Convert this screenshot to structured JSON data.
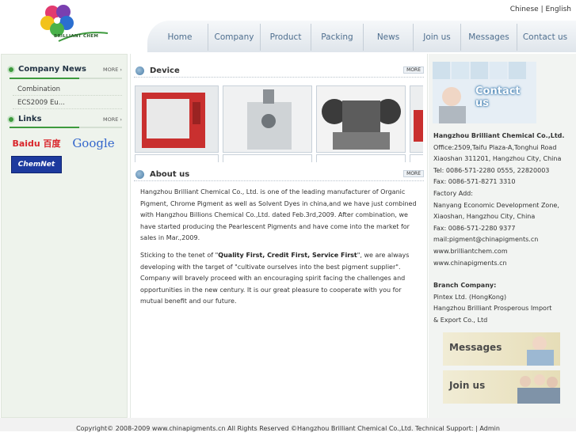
{
  "logo": {
    "text": "BRILLIANT CHEM"
  },
  "lang": {
    "chinese": "Chinese",
    "sep": "|",
    "english": "English"
  },
  "nav": [
    "Home",
    "Company",
    "Product",
    "Packing",
    "News",
    "Join us",
    "Messages",
    "Contact us"
  ],
  "sidebar": {
    "news_title": "Company News",
    "news_more": "MORE ›",
    "news": [
      "Combination",
      "ECS2009 Eu..."
    ],
    "links_title": "Links",
    "links_more": "MORE ›",
    "links": [
      "Baidu 百度",
      "Google",
      "ChemNet"
    ]
  },
  "main": {
    "device_title": "Device",
    "device_more": "MORE",
    "about_title": "About us",
    "about_more": "MORE",
    "about_p1": "Hangzhou Brilliant Chemical Co., Ltd. is one of the leading manufacturer of Organic Pigment, Chrome Pigment as well as Solvent Dyes in china,and we have just combined with Hangzhou Billions Chemical Co.,Ltd. dated Feb.3rd,2009. After combination, we have started producing the Pearlescent Pigments and have come into the market for sales in Mar.,2009.",
    "about_p2_a": "Sticking to the tenet of \"",
    "about_p2_bold": "Quality First, Credit First, Service First",
    "about_p2_b": "\", we are always developing with the target of \"cultivate ourselves into the best pigment supplier\". Company will bravely proceed with an encouraging spirit facing the challenges and opportunities in the new century. It is our great pleasure to cooperate with you for mutual benefit and our future."
  },
  "right": {
    "banner_text": "Contact us",
    "company": "Hangzhou Brilliant Chemical Co.,Ltd.",
    "lines": [
      "Office:2509,Taifu Plaza-A,Tonghui Road",
      "Xiaoshan 311201, Hangzhou City, China",
      "Tel:  0086-571-2280 0555, 22820003",
      "Fax:  0086-571-8271 3310",
      "Factory Add:",
      "Nanyang Economic Development Zone,",
      "Xiaoshan, Hangzhou City, China",
      "Fax:  0086-571-2280 9377",
      "mail:pigment@chinapigments.cn",
      "www.brilliantchem.com",
      "www.chinapigments.cn"
    ],
    "branch_title": "Branch Company:",
    "branch_lines": [
      "Pintex Ltd. (HongKong)",
      "Hangzhou Brilliant Prosperous Import",
      "& Export Co., Ltd"
    ],
    "messages_btn": "Messages",
    "joinus_btn": "Join us"
  },
  "footer": "Copyright© 2008-2009 www.chinapigments.cn All Rights Reserved ©Hangzhou Brilliant Chemical Co.,Ltd. Technical Support:     | Admin",
  "colors": {
    "nav_text": "#4f6f8f",
    "accent_green": "#3d9a3d",
    "section_blue": "#4b7ea8"
  }
}
